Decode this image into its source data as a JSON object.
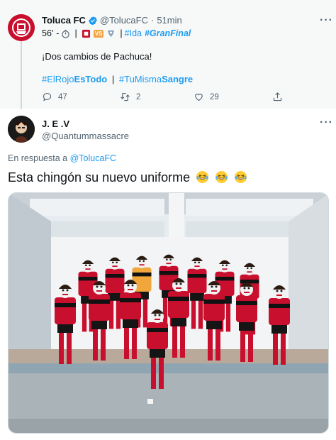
{
  "parent_tweet": {
    "author_name": "Toluca FC",
    "author_handle": "@TolucaFC",
    "separator": "·",
    "time": "51min",
    "score_line": {
      "minute": "56'",
      "dash": "-",
      "vs_label": "VS",
      "hashtag_ida": "#Ida",
      "hashtag_granfinal": "#GranFinal",
      "pipe": "|"
    },
    "text": "¡Dos cambios de Pachuca!",
    "hashtags": {
      "elrojo_a": "#ElRojo",
      "elrojo_b": "EsTodo",
      "pipe": "|",
      "tumisma_a": "#TuMisma",
      "tumisma_b": "Sangre"
    },
    "stats": {
      "replies": "47",
      "retweets": "2",
      "likes": "29"
    },
    "more_label": "···"
  },
  "reply_tweet": {
    "author_name": "J. E .V",
    "author_handle": "@Quantummassacre",
    "reply_prefix": "En respuesta a",
    "reply_target": "@TolucaFC",
    "text": "Esta chingón su nuevo uniforme",
    "emojis": [
      "laughing-tears-emoji",
      "laughing-tears-emoji",
      "laughing-tears-emoji"
    ],
    "more_label": "···",
    "photo_description_icon": "team-photo-image"
  },
  "colors": {
    "link_blue": "#1d9bf0",
    "muted": "#536471",
    "text": "#0f1419",
    "parent_bg": "#f7f9f9",
    "toluca_red": "#c8102e"
  }
}
